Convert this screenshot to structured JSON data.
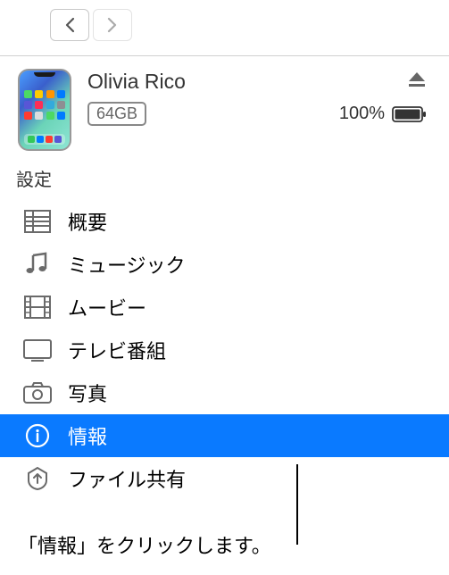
{
  "nav": {
    "back_label": "戻る",
    "forward_label": "進む"
  },
  "device": {
    "name": "Olivia Rico",
    "storage_label": "64GB",
    "battery_percent": "100%",
    "eject_label": "取り出す"
  },
  "sidebar": {
    "section_title": "設定",
    "items": [
      {
        "icon": "summary-icon",
        "label": "概要"
      },
      {
        "icon": "music-icon",
        "label": "ミュージック"
      },
      {
        "icon": "movies-icon",
        "label": "ムービー"
      },
      {
        "icon": "tv-icon",
        "label": "テレビ番組"
      },
      {
        "icon": "photos-icon",
        "label": "写真"
      },
      {
        "icon": "info-icon",
        "label": "情報",
        "selected": true
      },
      {
        "icon": "file-share-icon",
        "label": "ファイル共有"
      }
    ]
  },
  "hint": {
    "text": "「情報」をクリックします。"
  },
  "app_colors": [
    "#4cd964",
    "#ffcc00",
    "#ff9500",
    "#007aff",
    "#5856d6",
    "#ff2d55",
    "#34aadc",
    "#8e8e93",
    "#ff3b30",
    "#dbddde",
    "#4cd964",
    "#007aff"
  ],
  "dock_colors": [
    "#34c759",
    "#007aff",
    "#ff3b30",
    "#5856d6"
  ]
}
